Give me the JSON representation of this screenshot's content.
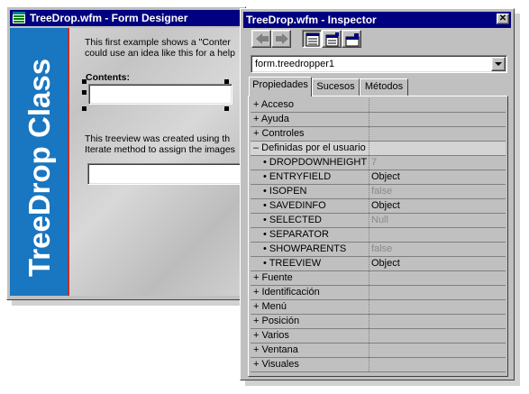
{
  "form_designer": {
    "title": "TreeDrop.wfm - Form Designer",
    "banner_text": "TreeDrop Class",
    "paragraph1_line1": "This first example shows a \"Conter",
    "paragraph1_line2": "could use an idea like this for a help",
    "contents_label": "Contents:",
    "paragraph2_line1": "This treeview was created using th",
    "paragraph2_line2": "Iterate method to assign the images"
  },
  "inspector": {
    "title": "TreeDrop.wfm - Inspector",
    "close_glyph": "✕",
    "object_combo_value": "form.treedropper1",
    "tabs": [
      {
        "label": "Propiedades",
        "active": true
      },
      {
        "label": "Sucesos",
        "active": false
      },
      {
        "label": "Métodos",
        "active": false
      }
    ],
    "properties": [
      {
        "name": "+ Acceso",
        "value": "",
        "dim": false
      },
      {
        "name": "+ Ayuda",
        "value": "",
        "dim": false
      },
      {
        "name": "+ Controles",
        "value": "",
        "dim": false
      },
      {
        "name": "– Definidas por el usuario",
        "value": "",
        "dim": false,
        "selected": true
      },
      {
        "name": "• DROPDOWNHEIGHT",
        "value": "7",
        "dim": true,
        "indent": true
      },
      {
        "name": "• ENTRYFIELD",
        "value": "Object",
        "dim": false,
        "indent": true
      },
      {
        "name": "• ISOPEN",
        "value": "false",
        "dim": true,
        "indent": true
      },
      {
        "name": "• SAVEDINFO",
        "value": "Object",
        "dim": false,
        "indent": true
      },
      {
        "name": "• SELECTED",
        "value": "Null",
        "dim": true,
        "indent": true
      },
      {
        "name": "• SEPARATOR",
        "value": "",
        "dim": false,
        "indent": true
      },
      {
        "name": "• SHOWPARENTS",
        "value": "false",
        "dim": true,
        "indent": true
      },
      {
        "name": "• TREEVIEW",
        "value": "Object",
        "dim": false,
        "indent": true
      },
      {
        "name": "+ Fuente",
        "value": "",
        "dim": false
      },
      {
        "name": "+ Identificación",
        "value": "",
        "dim": false
      },
      {
        "name": "+ Menú",
        "value": "",
        "dim": false
      },
      {
        "name": "+ Posición",
        "value": "",
        "dim": false
      },
      {
        "name": "+ Varios",
        "value": "",
        "dim": false
      },
      {
        "name": "+ Ventana",
        "value": "",
        "dim": false
      },
      {
        "name": "+ Visuales",
        "value": "",
        "dim": false
      }
    ]
  }
}
